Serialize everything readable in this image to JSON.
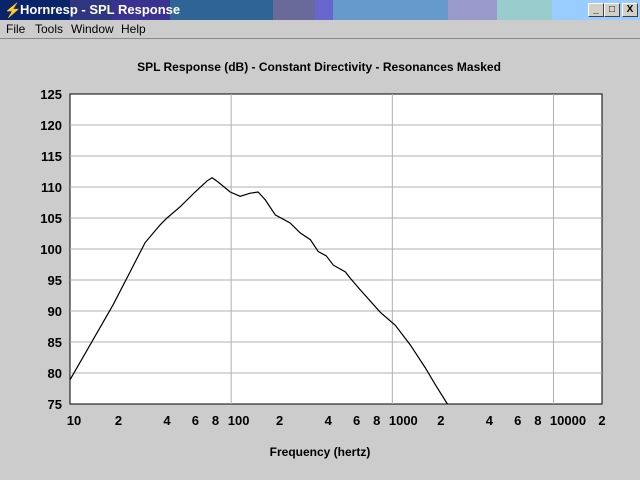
{
  "window": {
    "title": "Hornresp - SPL Response",
    "min": "_",
    "max": "□",
    "close": "X"
  },
  "menu": [
    "File",
    "Tools",
    "Window",
    "Help"
  ],
  "chart_data": {
    "type": "line",
    "title": "SPL Response (dB) - Constant Directivity - Resonances Masked",
    "xlabel": "Frequency (hertz)",
    "ylabel": "",
    "xscale": "log",
    "xlim": [
      10,
      20000
    ],
    "ylim": [
      75,
      125
    ],
    "yticks": [
      75,
      80,
      85,
      90,
      95,
      100,
      105,
      110,
      115,
      120,
      125
    ],
    "xticks": [
      {
        "v": 10,
        "l": "10"
      },
      {
        "v": 20,
        "l": "2"
      },
      {
        "v": 40,
        "l": "4"
      },
      {
        "v": 60,
        "l": "6"
      },
      {
        "v": 80,
        "l": "8"
      },
      {
        "v": 100,
        "l": "100"
      },
      {
        "v": 200,
        "l": "2"
      },
      {
        "v": 400,
        "l": "4"
      },
      {
        "v": 600,
        "l": "6"
      },
      {
        "v": 800,
        "l": "8"
      },
      {
        "v": 1000,
        "l": "1000"
      },
      {
        "v": 2000,
        "l": "2"
      },
      {
        "v": 4000,
        "l": "4"
      },
      {
        "v": 6000,
        "l": "6"
      },
      {
        "v": 8000,
        "l": "8"
      },
      {
        "v": 10000,
        "l": "10000"
      },
      {
        "v": 20000,
        "l": "2"
      }
    ],
    "grid": true,
    "series": [
      {
        "name": "SPL",
        "color": "#000000",
        "x": [
          10,
          13.3,
          18.5,
          23.6,
          29.2,
          36.3,
          40,
          48.2,
          59.7,
          71,
          76.2,
          83,
          98.6,
          113.8,
          131,
          147,
          163,
          188,
          232,
          268,
          310,
          347,
          389,
          430,
          511,
          548,
          633,
          841,
          1044,
          1294,
          1604,
          1851,
          2197
        ],
        "y": [
          78.9,
          84.5,
          91.0,
          96.3,
          101.0,
          103.9,
          105.0,
          106.8,
          109.2,
          111.0,
          111.5,
          110.8,
          109.2,
          108.5,
          109.0,
          109.2,
          107.9,
          105.5,
          104.2,
          102.6,
          101.5,
          99.6,
          98.9,
          97.4,
          96.3,
          95.3,
          93.4,
          89.8,
          87.7,
          84.5,
          80.8,
          78.1,
          75.0
        ]
      }
    ]
  }
}
